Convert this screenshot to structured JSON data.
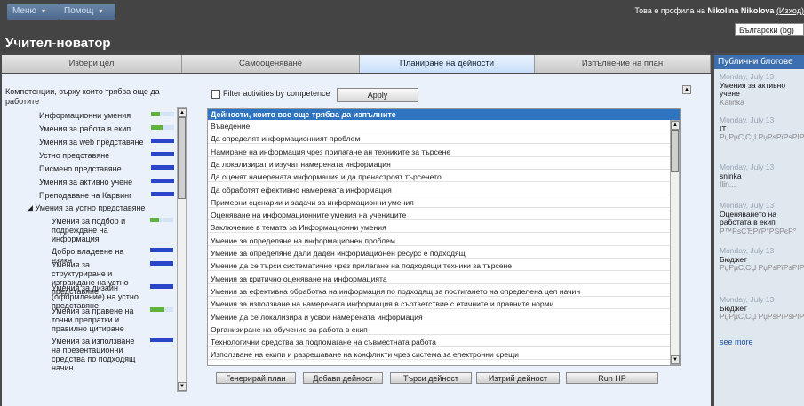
{
  "menu": {
    "menu_label": "Меню",
    "help_label": "Помощ"
  },
  "profile": {
    "prefix": "Това е профила на",
    "name": "Nikolina Nikolova",
    "change": "(Изход)",
    "language": "Български (bg)"
  },
  "app_title": "Учител-новатор",
  "tabs": [
    {
      "label": "Избери цел"
    },
    {
      "label": "Самооценяване"
    },
    {
      "label": "Планиране на дейности",
      "active": true
    },
    {
      "label": "Изпълнение на план"
    }
  ],
  "left": {
    "header": "Компетенции, върху които трябва още да работите",
    "items": [
      {
        "label": "Информационни умения",
        "level": 0.4
      },
      {
        "label": "Умения за работа в екип",
        "level": 0.5
      },
      {
        "label": "Умения за web представяне",
        "level": 1.0
      },
      {
        "label": "Устно представяне",
        "level": 1.0
      },
      {
        "label": "Писмено представяне",
        "level": 1.0
      },
      {
        "label": "Умения за активно учене",
        "level": 1.0
      },
      {
        "label": "Преподаване на Карвинг",
        "level": 1.0
      },
      {
        "label": "◢ Умения за устно представяне",
        "level": null
      },
      {
        "label": "Умения за подбор и подреждане на информация",
        "level": 0.4
      },
      {
        "label": "Добро владеене на езика",
        "level": 1.0
      },
      {
        "label": "Умения за структуриране и изграждане на устно представяне",
        "level": 1.0
      },
      {
        "label": "Умения за дизайн (оформление) на устно представяне",
        "level": 1.0
      },
      {
        "label": "Умения за правене на точни препратки и правилно цитиране",
        "level": 0.6
      },
      {
        "label": "Умения за използване на презентационни средства по подходящ начин",
        "level": 1.0
      }
    ]
  },
  "filter": {
    "label": "Filter activities by competence",
    "apply": "Apply"
  },
  "activities": {
    "header": "Дейности, които все още трябва да изпълните",
    "rows": [
      "Въведение",
      "Да определят информационният проблем",
      "Намиране на информация чрез прилагане ан техниките за търсене",
      "Да локализират и изучат намерената информация",
      "Да оценят намерената информация и да пренастроят търсенето",
      "Да обработят ефективно намерената информация",
      "Примерни сценарии и задачи за информационни умения",
      "Оценяване на информационните умения на учениците",
      "Заключение в темата за Информационни умения",
      "Умение за определяне на информационен проблем",
      "Умение за определяне дали даден информационен ресурс е подходящ",
      "Умение да се търси систематично чрез прилагане на подходящи техники за търсене",
      "Умения за критично оценяване на информацията",
      "Умения за ефективна обработка на информация по подходящ за постигането на определена цел начин",
      "Умения за използване на намерената информация в съответствие с етичните и правните норми",
      "Умение да се локализира и усвои намерената информация",
      "Организиране на обучение за работа в екип",
      "Технологични средства за подпомагане на съвместната работа",
      "Използване на екипи и разрешаване на конфликти чрез система за електронни срещи"
    ]
  },
  "buttons": {
    "generate": "Генерирай план",
    "add": "Добави дейност",
    "search": "Търси дейност",
    "delete": "Изтрий дейност",
    "run": "Run HP"
  },
  "blogs": {
    "title": "Публични блогове",
    "posts": [
      {
        "date": "Monday, July 13",
        "title": "Умения за активно учене",
        "author": "Kalinka"
      },
      {
        "date": "Monday, July 13",
        "title": "IT",
        "author": "РџРµС‚СЏ РџРѕРїРѕРІР°"
      },
      {
        "date": "Monday, July 13",
        "title": "sninka",
        "author": "Ilin..."
      },
      {
        "date": "Monday, July 13",
        "title": "Оценяването на работата в екип",
        "author": "Р™РѕСЂРґР°РЅРєР°"
      },
      {
        "date": "Monday, July 13",
        "title": "Бюджет",
        "author": "РџРµС‚СЏ РџРѕРїРѕРІР°"
      },
      {
        "date": "Monday, July 13",
        "title": "Бюджет",
        "author": "РџРµС‚СЏ РџРѕРїРѕРІР°"
      }
    ],
    "see_more": "see more"
  },
  "colors": {
    "accent": "#2e74c0",
    "meter_good": "#2a46c8",
    "meter_partial": "#5fb33a",
    "topbar": "#444444"
  }
}
